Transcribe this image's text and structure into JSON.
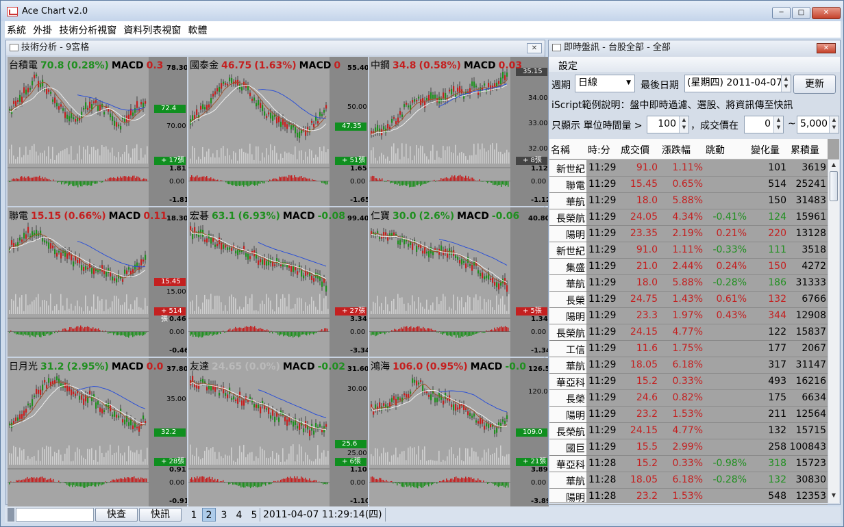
{
  "app": {
    "title": "Ace Chart v2.0"
  },
  "menu": [
    "系統",
    "外掛",
    "技術分析視窗",
    "資料列表視窗",
    "軟體"
  ],
  "left_panel": {
    "title": "技術分析 - 9宮格"
  },
  "colors": {
    "up": "#c41f1f",
    "down": "#1f8f1f",
    "ma_blue": "#2a4fd6",
    "ma_brown": "#a0522d",
    "ma_white": "#f0f0f0"
  },
  "charts": [
    {
      "name": "台積電",
      "price": "70.8",
      "change": "(0.28%)",
      "dir": "dn",
      "macd_label": "MACD",
      "macd": "0.3",
      "macd_dir": "up",
      "ticks": [
        {
          "t": "78.30",
          "v": 0.08,
          "b": true
        },
        {
          "t": "70.00",
          "v": 0.47
        }
      ],
      "price_tag": {
        "t": "72.4",
        "v": 0.35,
        "c": "g"
      },
      "vol_tag": {
        "t": "+ 17張",
        "c": "g"
      },
      "macd_ticks": [
        "1.81",
        "0.00",
        "-1.81"
      ],
      "trend": [
        0.6,
        0.45,
        0.3,
        0.1,
        0.25,
        0.4,
        0.55,
        0.7,
        0.6,
        0.45,
        0.5,
        0.62,
        0.75,
        0.65,
        0.5,
        0.45
      ]
    },
    {
      "name": "國泰金",
      "price": "46.75",
      "change": "(1.63%)",
      "dir": "up",
      "macd_label": "MACD",
      "macd": "0",
      "macd_dir": "up",
      "ticks": [
        {
          "t": "55.40",
          "v": 0.08,
          "b": true
        },
        {
          "t": "50.00",
          "v": 0.34
        }
      ],
      "price_tag": {
        "t": "47.35",
        "v": 0.47,
        "c": "g"
      },
      "vol_tag": {
        "t": "+ 51張",
        "c": "g"
      },
      "macd_ticks": [
        "1.65",
        "0.00",
        "-1.65"
      ],
      "trend": [
        0.7,
        0.6,
        0.5,
        0.3,
        0.2,
        0.15,
        0.25,
        0.4,
        0.55,
        0.65,
        0.7,
        0.75,
        0.9,
        0.8,
        0.65,
        0.5
      ]
    },
    {
      "name": "中鋼",
      "price": "34.8",
      "change": "(0.58%)",
      "dir": "up",
      "macd_label": "MACD",
      "macd": "0.03",
      "macd_dir": "up",
      "ticks": [
        {
          "t": "34.00",
          "v": 0.28
        },
        {
          "t": "33.00",
          "v": 0.45
        },
        {
          "t": "32.00",
          "v": 0.62
        }
      ],
      "price_tag": {
        "t": "35.15",
        "v": 0.1,
        "c": "k"
      },
      "vol_tag": {
        "t": "+ 8張",
        "c": "k"
      },
      "macd_ticks": [
        "1.12",
        "0.00",
        "-1.12"
      ],
      "trend": [
        0.9,
        0.85,
        0.75,
        0.7,
        0.5,
        0.4,
        0.45,
        0.35,
        0.4,
        0.3,
        0.35,
        0.25,
        0.3,
        0.2,
        0.15,
        0.1
      ]
    },
    {
      "name": "聯電",
      "price": "15.15",
      "change": "(0.66%)",
      "dir": "up",
      "macd_label": "MACD",
      "macd": "0.11",
      "macd_dir": "up",
      "ticks": [
        {
          "t": "18.30",
          "v": 0.08,
          "b": true
        },
        {
          "t": "15.00",
          "v": 0.57
        }
      ],
      "price_tag": {
        "t": "15.45",
        "v": 0.5,
        "c": "r"
      },
      "vol_tag": {
        "t": "+ 514張",
        "c": "r"
      },
      "macd_ticks": [
        "0.46",
        "0.00",
        "-0.46"
      ],
      "trend": [
        0.4,
        0.3,
        0.2,
        0.15,
        0.25,
        0.4,
        0.45,
        0.55,
        0.6,
        0.65,
        0.7,
        0.75,
        0.8,
        0.7,
        0.6,
        0.55
      ]
    },
    {
      "name": "宏碁",
      "price": "63.1",
      "change": "(6.93%)",
      "dir": "dn",
      "macd_label": "MACD",
      "macd": "-0.08",
      "macd_dir": "dn",
      "ticks": [
        {
          "t": "99.40",
          "v": 0.08,
          "b": true
        }
      ],
      "price_tag": {
        "t": "",
        "v": 0.0,
        "c": "none"
      },
      "vol_tag": {
        "t": "+ 27張",
        "c": "r"
      },
      "macd_ticks": [
        "3.34",
        "0.00",
        "-3.34"
      ],
      "trend": [
        0.15,
        0.2,
        0.25,
        0.3,
        0.35,
        0.4,
        0.45,
        0.5,
        0.55,
        0.6,
        0.62,
        0.65,
        0.7,
        0.75,
        0.8,
        0.9
      ]
    },
    {
      "name": "仁寶",
      "price": "30.0",
      "change": "(2.6%)",
      "dir": "dn",
      "macd_label": "MACD",
      "macd": "-0.06",
      "macd_dir": "dn",
      "ticks": [
        {
          "t": "40.80",
          "v": 0.08,
          "b": true
        }
      ],
      "price_tag": {
        "t": "",
        "v": 0.0,
        "c": "none"
      },
      "vol_tag": {
        "t": "+ 5張",
        "c": "r"
      },
      "macd_ticks": [
        "1.34",
        "0.00",
        "-1.34"
      ],
      "trend": [
        0.15,
        0.2,
        0.22,
        0.25,
        0.3,
        0.35,
        0.4,
        0.42,
        0.45,
        0.5,
        0.55,
        0.6,
        0.7,
        0.8,
        0.85,
        0.9
      ]
    },
    {
      "name": "日月光",
      "price": "31.2",
      "change": "(2.95%)",
      "dir": "dn",
      "macd_label": "MACD",
      "macd": "0.0",
      "macd_dir": "up",
      "ticks": [
        {
          "t": "37.80",
          "v": 0.08,
          "b": true
        },
        {
          "t": "35.00",
          "v": 0.28
        }
      ],
      "price_tag": {
        "t": "32.2",
        "v": 0.5,
        "c": "g"
      },
      "vol_tag": {
        "t": "+ 28張",
        "c": "g"
      },
      "macd_ticks": [
        "0.91",
        "0.00",
        "-0.91"
      ],
      "trend": [
        0.8,
        0.7,
        0.5,
        0.35,
        0.2,
        0.1,
        0.25,
        0.3,
        0.4,
        0.35,
        0.5,
        0.55,
        0.6,
        0.7,
        0.75,
        0.65
      ]
    },
    {
      "name": "友達",
      "price": "24.65",
      "change": "(0.0%)",
      "dir": "gray",
      "macd_label": "MACD",
      "macd": "-0.02",
      "macd_dir": "dn",
      "ticks": [
        {
          "t": "31.60",
          "v": 0.08,
          "b": true
        },
        {
          "t": "30.00",
          "v": 0.21
        },
        {
          "t": "25.00",
          "v": 0.64
        }
      ],
      "price_tag": {
        "t": "25.6",
        "v": 0.58,
        "c": "g"
      },
      "vol_tag": {
        "t": "+ 6張",
        "c": "g"
      },
      "macd_ticks": [
        "1.10",
        "0.00",
        "-1.10"
      ],
      "trend": [
        0.15,
        0.18,
        0.2,
        0.25,
        0.3,
        0.35,
        0.4,
        0.45,
        0.5,
        0.6,
        0.62,
        0.7,
        0.75,
        0.8,
        0.78,
        0.72
      ]
    },
    {
      "name": "鴻海",
      "price": "106.0",
      "change": "(0.95%)",
      "dir": "up",
      "macd_label": "MACD",
      "macd": "-0.0",
      "macd_dir": "dn",
      "ticks": [
        {
          "t": "126.50",
          "v": 0.08,
          "b": true
        },
        {
          "t": "120.00",
          "v": 0.23
        }
      ],
      "price_tag": {
        "t": "109.0",
        "v": 0.5,
        "c": "g"
      },
      "vol_tag": {
        "t": "+ 21張",
        "c": "g"
      },
      "macd_ticks": [
        "3.89",
        "0.00",
        "-3.89"
      ],
      "trend": [
        0.55,
        0.5,
        0.45,
        0.4,
        0.35,
        0.1,
        0.3,
        0.35,
        0.4,
        0.45,
        0.5,
        0.6,
        0.7,
        0.8,
        0.75,
        0.6
      ]
    }
  ],
  "right_panel": {
    "title": "即時盤訊 - 台股全部 - 全部",
    "settings_label": "設定",
    "period_label": "週期",
    "period_value": "日線",
    "lastdate_label": "最後日期",
    "lastdate_value": "(星期四) 2011-04-07",
    "update_label": "更新",
    "info_text": "iScript範例說明：盤中即時過濾、選股、將資訊傳至快訊",
    "filter_show_label": "只顯示 單位時間量 >",
    "filter_vol_value": "100",
    "filter_price_label": "，成交價在",
    "filter_price_min": "0",
    "filter_tilde": "~",
    "filter_price_max": "5,000",
    "columns": [
      "名稱",
      "時:分",
      "成交價",
      "漲跌幅",
      "跳動",
      "變化量",
      "累積量"
    ],
    "rows": [
      [
        "新世紀",
        "11:29",
        "91.0",
        "1.11%",
        "",
        "101",
        "3619",
        "up"
      ],
      [
        "聯電",
        "11:29",
        "15.45",
        "0.65%",
        "",
        "514",
        "25241",
        "up"
      ],
      [
        "華航",
        "11:29",
        "18.0",
        "5.88%",
        "",
        "150",
        "31483",
        "up"
      ],
      [
        "長榮航",
        "11:29",
        "24.05",
        "4.34%",
        "-0.41%",
        "124",
        "15961",
        "up"
      ],
      [
        "陽明",
        "11:29",
        "23.35",
        "2.19%",
        "0.21%",
        "220",
        "13128",
        "up"
      ],
      [
        "新世紀",
        "11:29",
        "91.0",
        "1.11%",
        "-0.33%",
        "111",
        "3518",
        "up"
      ],
      [
        "集盛",
        "11:29",
        "21.0",
        "2.44%",
        "0.24%",
        "150",
        "4272",
        "up"
      ],
      [
        "華航",
        "11:29",
        "18.0",
        "5.88%",
        "-0.28%",
        "186",
        "31333",
        "up"
      ],
      [
        "長榮",
        "11:29",
        "24.75",
        "1.43%",
        "0.61%",
        "132",
        "6766",
        "up"
      ],
      [
        "陽明",
        "11:29",
        "23.3",
        "1.97%",
        "0.43%",
        "344",
        "12908",
        "up"
      ],
      [
        "長榮航",
        "11:29",
        "24.15",
        "4.77%",
        "",
        "122",
        "15837",
        "up"
      ],
      [
        "工信",
        "11:29",
        "11.6",
        "1.75%",
        "",
        "177",
        "2067",
        "up"
      ],
      [
        "華航",
        "11:29",
        "18.05",
        "6.18%",
        "",
        "317",
        "31147",
        "up"
      ],
      [
        "華亞科",
        "11:29",
        "15.2",
        "0.33%",
        "",
        "493",
        "16216",
        "up"
      ],
      [
        "長榮",
        "11:29",
        "24.6",
        "0.82%",
        "",
        "175",
        "6634",
        "up"
      ],
      [
        "陽明",
        "11:29",
        "23.2",
        "1.53%",
        "",
        "211",
        "12564",
        "up"
      ],
      [
        "長榮航",
        "11:29",
        "24.15",
        "4.77%",
        "",
        "132",
        "15715",
        "up"
      ],
      [
        "國巨",
        "11:29",
        "15.5",
        "2.99%",
        "",
        "258",
        "100843",
        "up"
      ],
      [
        "華亞科",
        "11:28",
        "15.2",
        "0.33%",
        "-0.98%",
        "318",
        "15723",
        "up"
      ],
      [
        "華航",
        "11:28",
        "18.05",
        "6.18%",
        "-0.28%",
        "132",
        "30830",
        "up"
      ],
      [
        "陽明",
        "11:28",
        "23.2",
        "1.53%",
        "",
        "548",
        "12353",
        "up"
      ]
    ]
  },
  "statusbar": {
    "quick_query": "快查",
    "quick_news": "快訊",
    "pages": [
      "1",
      "2",
      "3",
      "4",
      "5"
    ],
    "selected_page": "2",
    "datetime": "2011-04-07 11:29:14(四)"
  }
}
